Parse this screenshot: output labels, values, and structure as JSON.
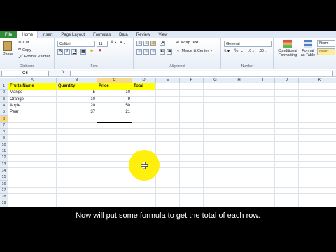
{
  "tabs": [
    "File",
    "Home",
    "Insert",
    "Page Layout",
    "Formulas",
    "Data",
    "Review",
    "View"
  ],
  "clipboard": {
    "paste": "Paste",
    "cut": "Cut",
    "copy": "Copy",
    "format_painter": "Format Painter",
    "label": "Clipboard"
  },
  "font": {
    "name": "Calibri",
    "size": "11",
    "label": "Font"
  },
  "alignment": {
    "wrap": "Wrap Text",
    "merge": "Merge & Center",
    "label": "Alignment"
  },
  "number": {
    "format": "General",
    "label": "Number"
  },
  "styles": {
    "conditional": "Conditional Formatting",
    "format_table": "Format as Table",
    "normal": "Norm",
    "neutral": "Neutr"
  },
  "formula_bar": {
    "name_box": "C6",
    "fx": "fx",
    "value": ""
  },
  "columns": [
    "A",
    "B",
    "C",
    "D",
    "E",
    "F",
    "G",
    "H",
    "I",
    "J",
    "K"
  ],
  "rows": [
    "1",
    "2",
    "3",
    "4",
    "5",
    "6",
    "7",
    "8",
    "9",
    "10",
    "11",
    "12",
    "13",
    "14",
    "15",
    "16",
    "17",
    "18",
    "19"
  ],
  "table": {
    "headers": [
      "Fruits Name",
      "Quantity",
      "Price",
      "Total"
    ],
    "data": [
      [
        "Mango",
        "5",
        "10"
      ],
      [
        "Orange",
        "10",
        "9"
      ],
      [
        "Apple",
        "20",
        "50"
      ],
      [
        "Pear",
        "37",
        "21"
      ]
    ]
  },
  "caption": "Now will put some formula to get the total of each row."
}
